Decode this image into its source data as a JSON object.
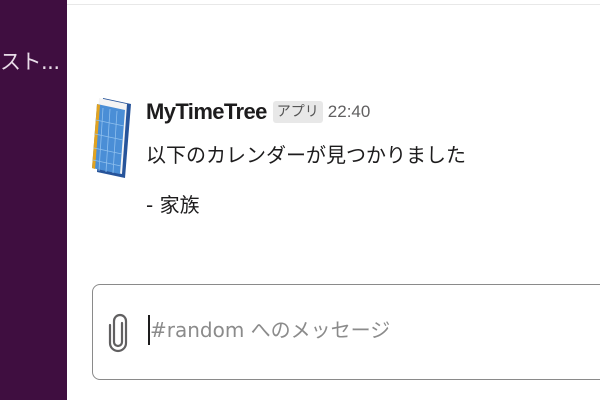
{
  "sidebar": {
    "channel_label": "スト..."
  },
  "message": {
    "sender": "MyTimeTree",
    "badge": "アプリ",
    "time": "22:40",
    "lines": [
      "以下のカレンダーが見つかりました",
      "- 家族"
    ],
    "avatar_icon": "timetree-app-icon"
  },
  "composer": {
    "placeholder": "#random へのメッセージ",
    "attach_icon": "paperclip-icon"
  },
  "colors": {
    "sidebar_bg": "#3f0e40",
    "text": "#1d1c1d",
    "muted": "#616061",
    "badge_bg": "#e8e8e8"
  }
}
